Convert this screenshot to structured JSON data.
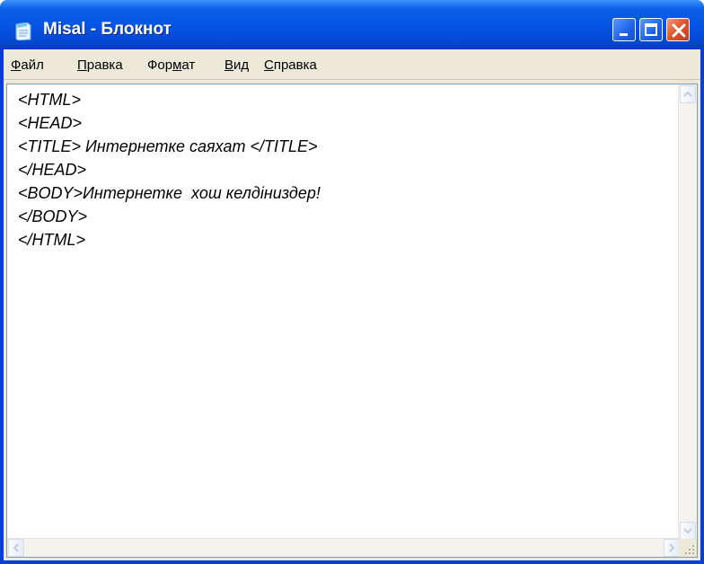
{
  "window": {
    "title": "Misal - Блокнот",
    "icon": "notepad-icon"
  },
  "titlebar_buttons": {
    "minimize": "minimize-icon",
    "maximize": "maximize-icon",
    "close": "close-icon"
  },
  "menu": {
    "file": {
      "accel": "Ф",
      "rest": "айл"
    },
    "edit": {
      "accel": "П",
      "rest": "равка"
    },
    "format": {
      "pre": "Фор",
      "accel": "м",
      "rest": "ат"
    },
    "view": {
      "accel": "В",
      "rest": "ид"
    },
    "help": {
      "accel": "С",
      "rest": "правка"
    }
  },
  "document": {
    "lines": [
      "<HTML>",
      "<HEAD>",
      "<TITLE> Интернетке саяхат </TITLE>",
      "</HEAD>",
      "<BODY>Интернетке  хош келдіниздер!",
      "</BODY>",
      "</HTML>"
    ]
  },
  "colors": {
    "titlebar": "#0553e4",
    "close_button": "#e0522c",
    "menu_bg": "#ece9d8"
  }
}
